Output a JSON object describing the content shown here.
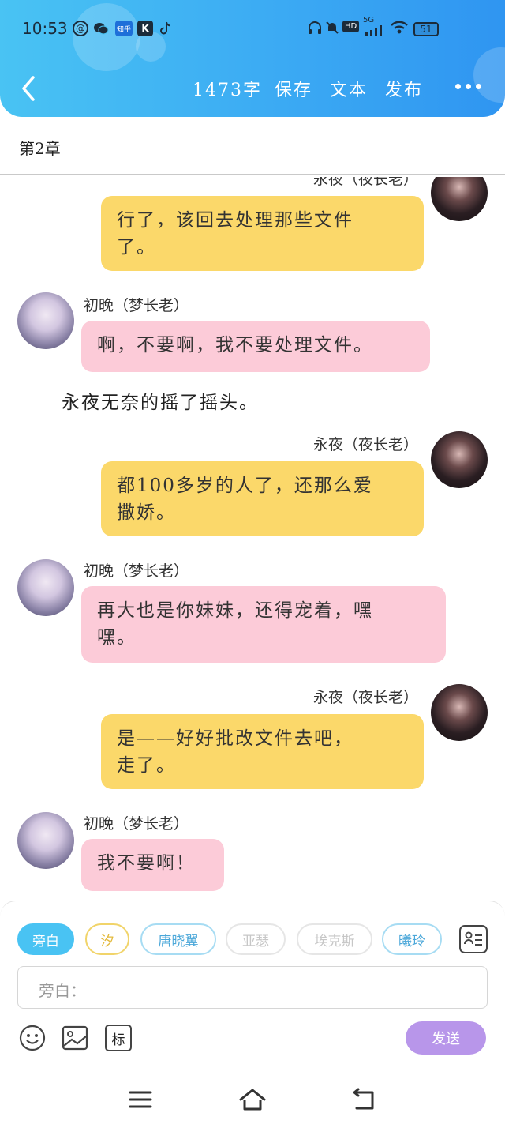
{
  "status_bar": {
    "time": "10:53",
    "app_icons": [
      "mail-icon",
      "wechat-icon",
      "zhihu-icon",
      "k-icon",
      "tiktok-icon"
    ],
    "zhihu_label": "知乎",
    "k_label": "K",
    "network": "5G",
    "battery": "51"
  },
  "toolbar": {
    "word_count": "1473字",
    "save": "保存",
    "text": "文本",
    "publish": "发布"
  },
  "chapter": {
    "title": "第2章"
  },
  "messages": [
    {
      "side": "right",
      "name": "永夜（夜长老）",
      "text_lines": [
        "行了，该回去处理那些文件",
        "了。"
      ],
      "color": "#fbd86a"
    },
    {
      "side": "left",
      "name": "初晚（梦长老）",
      "text_lines": [
        "啊，不要啊，我不要处理文件。"
      ],
      "color": "#fccbd8"
    },
    {
      "narration": "永夜无奈的摇了摇头。"
    },
    {
      "side": "right",
      "name": "永夜（夜长老）",
      "text_lines": [
        "都100多岁的人了，还那么爱",
        "撒娇。"
      ],
      "color": "#fbd86a"
    },
    {
      "side": "left",
      "name": "初晚（梦长老）",
      "text_lines": [
        "再大也是你妹妹，还得宠着，嘿",
        "嘿。"
      ],
      "color": "#fccbd8"
    },
    {
      "side": "right",
      "name": "永夜（夜长老）",
      "text_lines": [
        "是——好好批改文件去吧，",
        "走了。"
      ],
      "color": "#fbd86a"
    },
    {
      "side": "left",
      "name": "初晚（梦长老）",
      "text_lines": [
        "我不要啊！"
      ],
      "color": "#fccbd8"
    }
  ],
  "chips": [
    "旁白",
    "汐",
    "唐晓翼",
    "亚瑟",
    "埃克斯",
    "曦玲"
  ],
  "input": {
    "placeholder": "旁白："
  },
  "tools": {
    "label_btn": "标",
    "send": "发送"
  },
  "colors": {
    "accent": "#49c3f3",
    "send": "#b896ea",
    "yellow_bubble": "#fbd86a",
    "pink_bubble": "#fccbd8"
  }
}
